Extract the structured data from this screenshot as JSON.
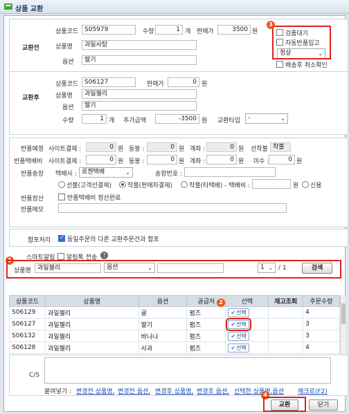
{
  "window": {
    "title": "상품 교환"
  },
  "before": {
    "section_label": "교환전",
    "code_label": "상품코드",
    "code": "S05979",
    "qty_label": "수량",
    "qty": "1",
    "qty_unit": "개",
    "price_label": "판매가",
    "price": "3500",
    "price_unit": "원",
    "name_label": "상품명",
    "name": "과일사탕",
    "option_label": "옵션",
    "option": "딸기",
    "checks": {
      "inspect": "검품대기",
      "auto_return": "자동반품입고",
      "cancel_confirm": "배송후 취소확인"
    },
    "status_select": "정상"
  },
  "after": {
    "section_label": "교환후",
    "code_label": "상품코드",
    "code": "S06127",
    "price_label": "판매가",
    "price": "0",
    "price_unit": "원",
    "name_label": "상품명",
    "name": "과일젤리",
    "option_label": "옵션",
    "option": "딸기",
    "qty_label": "수량",
    "qty": "1",
    "qty_unit": "개",
    "extra_label": "추가금액",
    "extra": "-3500",
    "extra_unit": "원",
    "type_label": "교환타입",
    "type_value": "-"
  },
  "return": {
    "plan_label": "반품예정",
    "site_pay_label": "사이트결제 :",
    "site_pay": "0",
    "won": "원",
    "same_label": "동봉 :",
    "same": "0",
    "account_label": "계좌 :",
    "account": "0",
    "prepaid_label": "선착불",
    "prepaid_value": "착불",
    "fee_label": "반품택배비",
    "site_pay2": "0",
    "same2": "0",
    "account2": "0",
    "unpaid_label": "미수 :",
    "unpaid": "0",
    "courier_label": "반품송장",
    "courier_co_label": "택배사 :",
    "courier_co": "로젠택배",
    "invoice_label": "송장번호 :",
    "radio1": "선불(고객선결제)",
    "radio2": "착불(판매자결제)",
    "radio3": "착불(타택배) - 택배비 :",
    "radio3_unit": "원",
    "radio4": "신용",
    "settle_label": "반품정산",
    "settle_check": "반품택배비 정산완료",
    "memo_label": "반품메모"
  },
  "merge": {
    "label": "합포처리",
    "check": "동일주문의 다른 교환주문건과 합포"
  },
  "smart": {
    "label": "스마트알림",
    "check": "알림톡 전송"
  },
  "search": {
    "name_label": "상품명",
    "name_value": "과일젤리",
    "option_select": "옵션",
    "page": "1",
    "page_total": "/ 1",
    "search_button": "검색"
  },
  "grid": {
    "headers": [
      "상품코드",
      "상품명",
      "옵션",
      "공급처",
      "선택",
      "재고조회",
      "주문수량"
    ],
    "select_label": "선택",
    "rows": [
      {
        "code": "S06129",
        "name": "과일젤리",
        "option": "귤",
        "supplier": "펌즈",
        "qty": "4"
      },
      {
        "code": "S06127",
        "name": "과일젤리",
        "option": "딸기",
        "supplier": "펌즈",
        "qty": "3"
      },
      {
        "code": "S06132",
        "name": "과일젤리",
        "option": "바나나",
        "supplier": "펌즈",
        "qty": "3"
      },
      {
        "code": "S06128",
        "name": "과일젤리",
        "option": "사과",
        "supplier": "펌즈",
        "qty": "4"
      }
    ]
  },
  "cs": {
    "label": "C/S",
    "paste_label": "붙여넣기 :",
    "links": [
      "변경전 상품명,",
      "변경전 옵션,",
      "변경후 상품명,",
      "변경후 옵션,",
      "선택한 상품명,옵션"
    ],
    "macro": "매크로(F2)"
  },
  "footer": {
    "exchange_button": "교환",
    "close_button": "닫기"
  },
  "badges": [
    "1",
    "2",
    "3",
    "4"
  ],
  "colors": {
    "accent": "#2a6fd6",
    "highlight": "#e02020",
    "badge": "#e8581a"
  }
}
